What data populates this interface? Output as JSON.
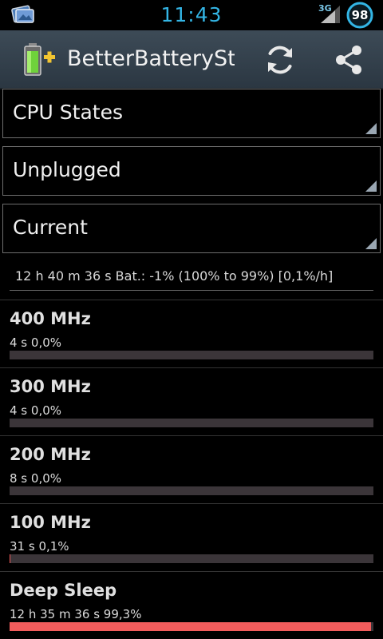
{
  "status_bar": {
    "time": "11:43",
    "network": "3G",
    "battery_level": "98",
    "accent": "#33b5e5"
  },
  "action_bar": {
    "title": "BetterBatterySt…",
    "icons": [
      "battery-plus-icon",
      "refresh-icon",
      "share-icon"
    ]
  },
  "spinners": [
    {
      "value": "CPU States"
    },
    {
      "value": "Unplugged"
    },
    {
      "value": "Current"
    }
  ],
  "summary": "12 h 40 m 36 s  Bat.: -1% (100% to 99%) [0,1%/h]",
  "states": [
    {
      "name": "400 MHz",
      "detail": "4 s  0,0%",
      "fraction": 0.0
    },
    {
      "name": "300 MHz",
      "detail": "4 s  0,0%",
      "fraction": 0.0
    },
    {
      "name": "200 MHz",
      "detail": "8 s  0,0%",
      "fraction": 0.0
    },
    {
      "name": "100 MHz",
      "detail": "31 s  0,1%",
      "fraction": 0.001
    },
    {
      "name": "Deep Sleep",
      "detail": "12 h 35 m 36 s  99,3%",
      "fraction": 0.993
    }
  ],
  "colors": {
    "bar_track": "#3b3539",
    "bar_fill": "#f25c5c"
  }
}
